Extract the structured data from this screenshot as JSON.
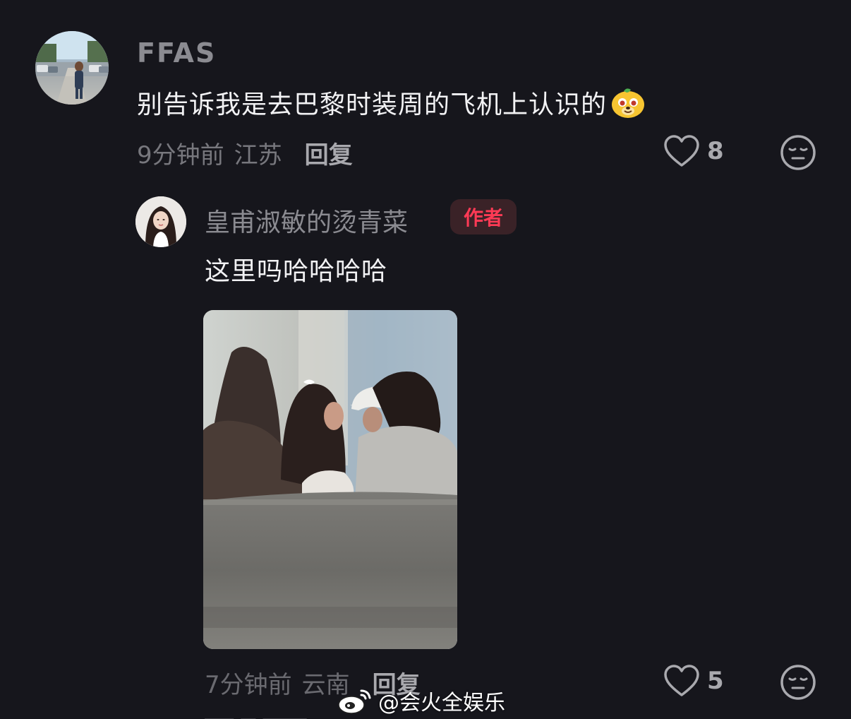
{
  "comment": {
    "username": "FFAS",
    "text": "别告诉我是去巴黎时装周的飞机上认识的",
    "emoji": "doge-face-icon",
    "time": "9分钟前",
    "region": "江苏",
    "reply_label": "回复",
    "like_count": "8"
  },
  "reply": {
    "username": "皇甫淑敏的烫青菜",
    "badge": "作者",
    "text": "这里吗哈哈哈哈",
    "time": "7分钟前",
    "region": "云南",
    "reply_label": "回复",
    "like_count": "5"
  },
  "watermark": {
    "text": "@会火全娱乐"
  },
  "colors": {
    "background": "#16161c",
    "author_badge_text": "#ff3a55",
    "author_badge_bg": "#3a2227"
  }
}
